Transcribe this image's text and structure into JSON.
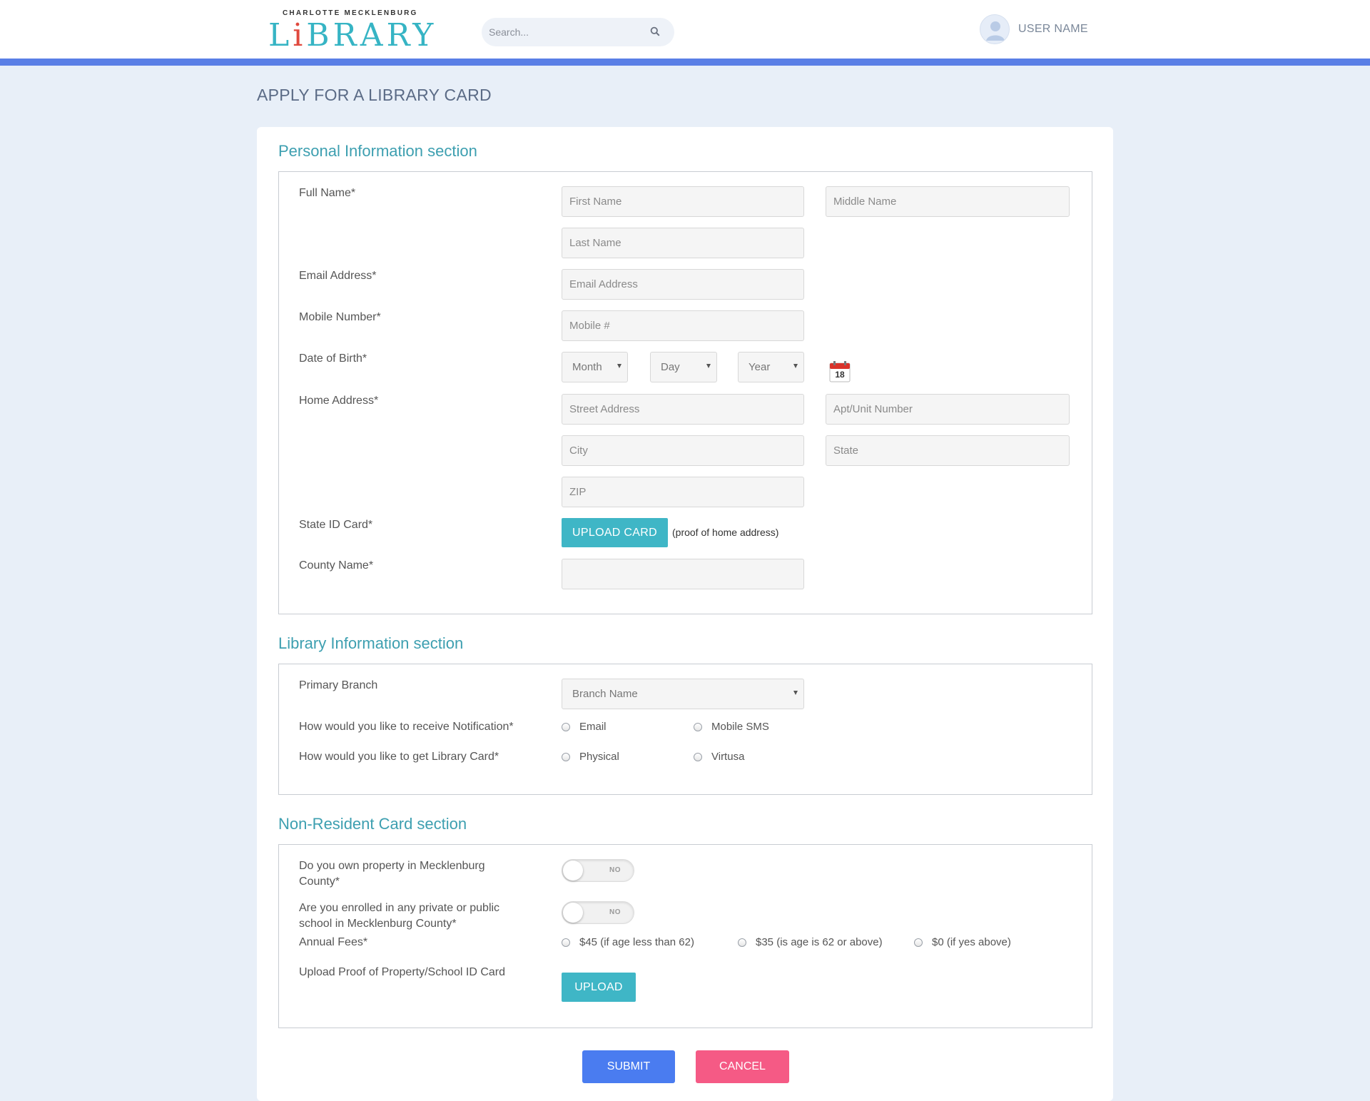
{
  "header": {
    "logo_top": "CHARLOTTE MECKLENBURG",
    "logo_main_pre": "L",
    "logo_main_i": "i",
    "logo_main_post": "BRARY",
    "search_placeholder": "Search...",
    "user_name": "USER NAME"
  },
  "page": {
    "title": "APPLY FOR A LIBRARY CARD"
  },
  "personal": {
    "title": "Personal Information section",
    "full_name_label": "Full Name*",
    "first_name_ph": "First Name",
    "middle_name_ph": "Middle Name",
    "last_name_ph": "Last Name",
    "email_label": "Email Address*",
    "email_ph": "Email Address",
    "mobile_label": "Mobile Number*",
    "mobile_ph": "Mobile #",
    "dob_label": "Date of Birth*",
    "month": "Month",
    "day": "Day",
    "year": "Year",
    "calendar_day": "18",
    "address_label": "Home Address*",
    "street_ph": "Street Address",
    "apt_ph": "Apt/Unit Number",
    "city_ph": "City",
    "state_ph": "State",
    "zip_ph": "ZIP",
    "state_id_label": "State ID Card*",
    "upload_card": "UPLOAD CARD",
    "upload_hint": "(proof of home address)",
    "county_label": "County Name*"
  },
  "library": {
    "title": "Library Information section",
    "branch_label": "Primary Branch",
    "branch_value": "Branch Name",
    "notification_label": "How would you like to receive Notification*",
    "notif_email": "Email",
    "notif_sms": "Mobile SMS",
    "card_type_label": "How would you like to get Library Card*",
    "card_physical": "Physical",
    "card_virtual": "Virtusa"
  },
  "nonresident": {
    "title": "Non-Resident Card section",
    "property_label": "Do you own property in Mecklenburg County*",
    "property_toggle": "NO",
    "school_label": "Are you enrolled in any private or public school in Mecklenburg County*",
    "school_toggle": "NO",
    "fees_label": "Annual Fees*",
    "fee_45": "$45 (if age less than 62)",
    "fee_35": "$35 (is age is 62 or above)",
    "fee_0": "$0 (if yes above)",
    "proof_label": "Upload Proof of Property/School ID Card",
    "upload": "UPLOAD"
  },
  "actions": {
    "submit": "SUBMIT",
    "cancel": "CANCEL"
  },
  "colors": {
    "accent": "#5a7fe6",
    "teal": "#3fb6c6",
    "section_title": "#3d9fb0",
    "submit": "#4a7cf0",
    "cancel": "#f55a85",
    "background": "#e8eff8"
  },
  "icons": {
    "search": "search-icon",
    "avatar": "user-avatar-icon",
    "calendar": "calendar-icon"
  }
}
